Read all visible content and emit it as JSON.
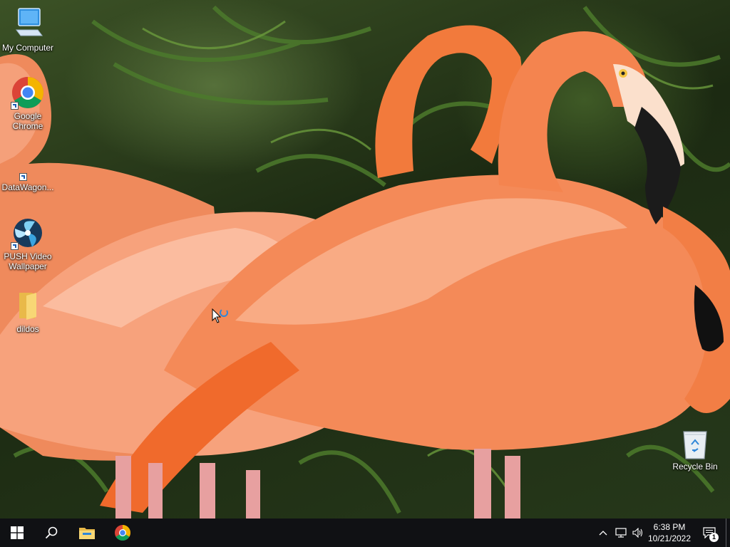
{
  "desktop": {
    "icons": [
      {
        "label": "My Computer",
        "icon": "computer-icon"
      },
      {
        "label": "Google Chrome",
        "icon": "chrome-icon"
      },
      {
        "label": "DataWagon...",
        "icon": "shortcut-icon"
      },
      {
        "label": "PUSH Video Wallpaper",
        "icon": "push-video-wallpaper-icon"
      },
      {
        "label": "dildos",
        "icon": "folder-icon"
      },
      {
        "label": "Recycle Bin",
        "icon": "recycle-bin-icon"
      }
    ],
    "wallpaper": "flamingos"
  },
  "taskbar": {
    "pinned": [
      {
        "name": "start",
        "icon": "windows-logo-icon"
      },
      {
        "name": "search",
        "icon": "search-icon"
      },
      {
        "name": "file-explorer",
        "icon": "file-explorer-icon"
      },
      {
        "name": "chrome",
        "icon": "chrome-icon"
      }
    ],
    "tray": {
      "icons": [
        "chevron-up-icon",
        "network-icon",
        "volume-icon"
      ],
      "time": "6:38 PM",
      "date": "10/21/2022",
      "notification_count": "1"
    }
  },
  "colors": {
    "taskbar": "#101114",
    "flamingo": "#f4844f",
    "accent": "#76b9ed"
  }
}
